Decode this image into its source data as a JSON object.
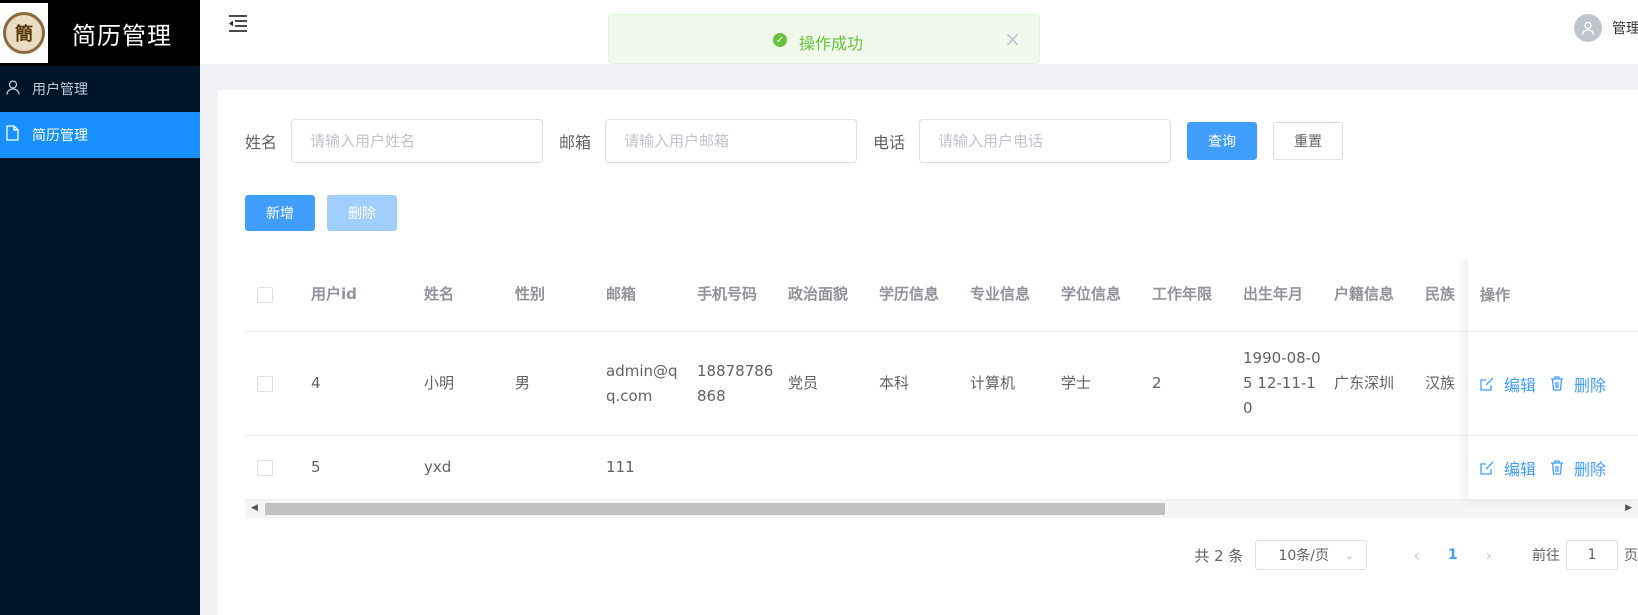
{
  "sidebar": {
    "title": "简历管理",
    "logo_char": "簡",
    "items": [
      {
        "label": "用户管理",
        "icon": "user-icon",
        "active": false
      },
      {
        "label": "简历管理",
        "icon": "document-icon",
        "active": true
      }
    ]
  },
  "header": {
    "user_name": "管理员"
  },
  "toast": {
    "message": "操作成功",
    "type": "success"
  },
  "filters": {
    "name_label": "姓名",
    "name_placeholder": "请输入用户姓名",
    "email_label": "邮箱",
    "email_placeholder": "请输入用户邮箱",
    "phone_label": "电话",
    "phone_placeholder": "请输入用户电话",
    "query_label": "查询",
    "reset_label": "重置"
  },
  "actions": {
    "add_label": "新增",
    "delete_label": "删除"
  },
  "table": {
    "columns": [
      "用户id",
      "姓名",
      "性别",
      "邮箱",
      "手机号码",
      "政治面貌",
      "学历信息",
      "专业信息",
      "学位信息",
      "工作年限",
      "出生年月",
      "户籍信息",
      "民族",
      "操作"
    ],
    "rows": [
      {
        "id": "4",
        "name": "小明",
        "gender": "男",
        "email": "admin@qq.com",
        "phone": "18878786868",
        "political": "党员",
        "education": "本科",
        "major": "计算机",
        "degree": "学士",
        "years": "2",
        "birth": "1990-08-05 12-11-10",
        "hometown": "广东深圳",
        "nation": "汉族"
      },
      {
        "id": "5",
        "name": "yxd",
        "gender": "",
        "email": "111",
        "phone": "",
        "political": "",
        "education": "",
        "major": "",
        "degree": "",
        "years": "",
        "birth": "",
        "hometown": "",
        "nation": ""
      }
    ],
    "edit_label": "编辑",
    "delete_label": "删除"
  },
  "pagination": {
    "total_text": "共 2 条",
    "page_size": "10条/页",
    "current_page": "1",
    "goto_label": "前往",
    "goto_value": "1",
    "page_suffix": "页"
  },
  "colors": {
    "sidebar_bg": "#001528",
    "active": "#1890ff",
    "primary": "#409eff",
    "success": "#67c23a"
  }
}
